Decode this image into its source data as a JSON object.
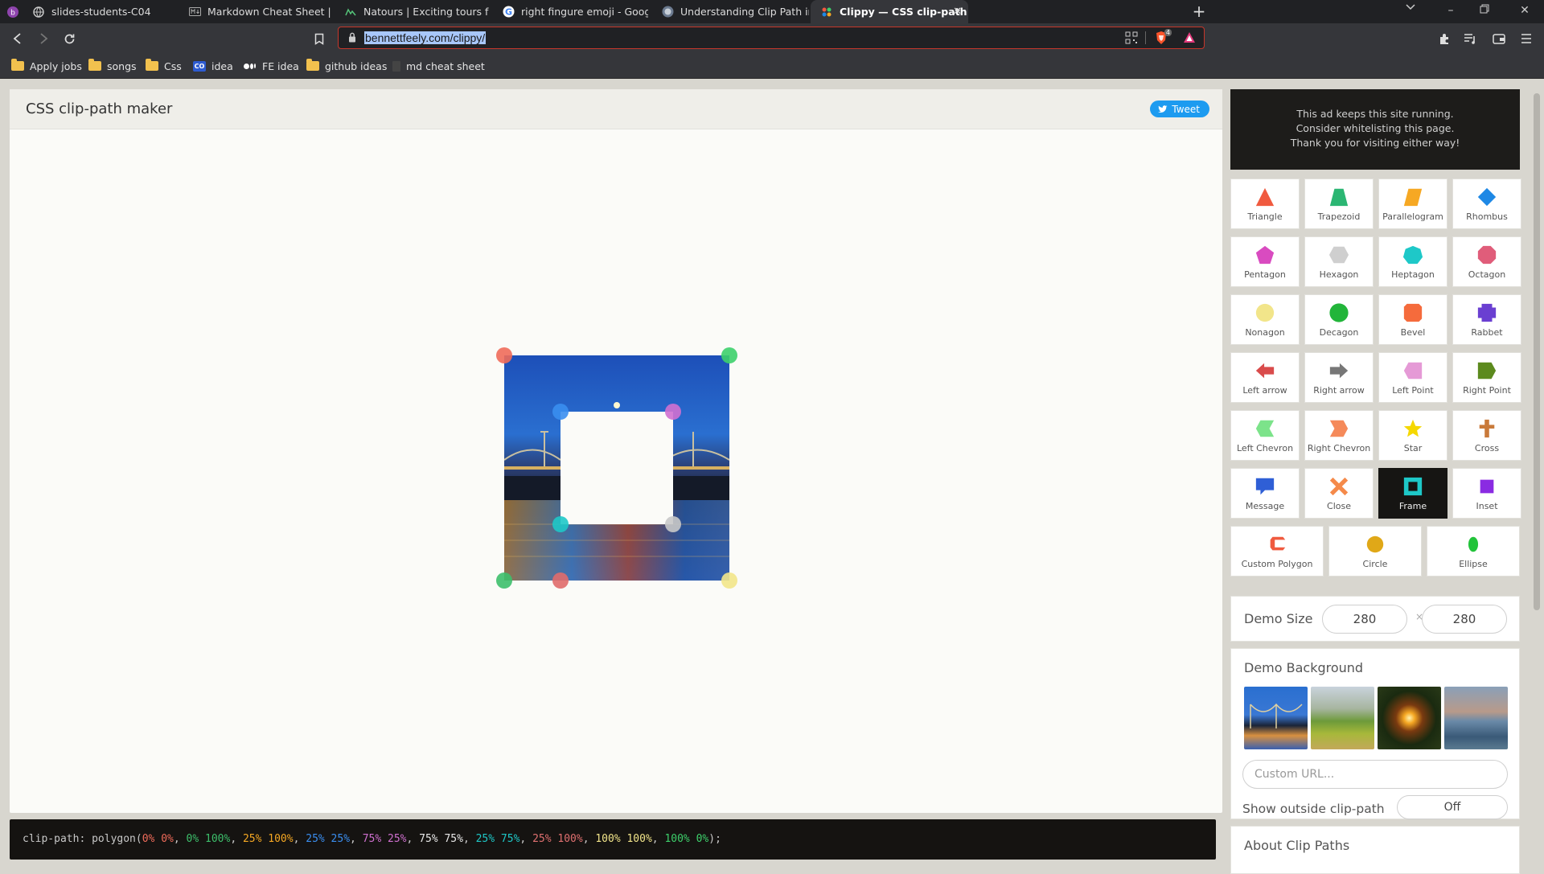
{
  "browser": {
    "tabs": [
      {
        "title": "slides-students-C04",
        "icon": "globe-icon"
      },
      {
        "title": "Markdown Cheat Sheet | Markdown G",
        "icon": "markdown-icon"
      },
      {
        "title": "Natours | Exciting tours for adventuro",
        "icon": "natours-icon"
      },
      {
        "title": "right fingure emoji - Google Search",
        "icon": "google-icon"
      },
      {
        "title": "Understanding Clip Path in CSS - Ahm",
        "icon": "globe-icon"
      },
      {
        "title": "Clippy — CSS clip-path maker",
        "icon": "clippy-icon",
        "active": true
      }
    ],
    "url": "bennettfeely.com/clippy/",
    "brave_badge": "4",
    "bookmarks": [
      {
        "label": "Apply jobs",
        "icon": "folder-icon"
      },
      {
        "label": "songs",
        "icon": "folder-icon"
      },
      {
        "label": "Css",
        "icon": "folder-icon"
      },
      {
        "label": "idea",
        "icon": "codepen-icon"
      },
      {
        "label": "FE idea",
        "icon": "medium-icon"
      },
      {
        "label": "github ideas",
        "icon": "folder-icon"
      },
      {
        "label": "md cheat sheet",
        "icon": "page-icon"
      }
    ]
  },
  "app": {
    "title": "CSS clip-path maker",
    "tweet_label": "Tweet",
    "ad_lines": [
      "This ad keeps this site running.",
      "Consider whitelisting this page.",
      "Thank you for visiting either way!"
    ],
    "shapes": [
      {
        "name": "Triangle",
        "color": "#f05a3f"
      },
      {
        "name": "Trapezoid",
        "color": "#2bb673"
      },
      {
        "name": "Parallelogram",
        "color": "#f6a823"
      },
      {
        "name": "Rhombus",
        "color": "#1e88e5"
      },
      {
        "name": "Pentagon",
        "color": "#d94bc0"
      },
      {
        "name": "Hexagon",
        "color": "#cfcfcf"
      },
      {
        "name": "Heptagon",
        "color": "#1ec8c8"
      },
      {
        "name": "Octagon",
        "color": "#e05d7a"
      },
      {
        "name": "Nonagon",
        "color": "#f2e58a"
      },
      {
        "name": "Decagon",
        "color": "#22b53a"
      },
      {
        "name": "Bevel",
        "color": "#f56b3c"
      },
      {
        "name": "Rabbet",
        "color": "#6a3fd1"
      },
      {
        "name": "Left arrow",
        "color": "#d94b4b"
      },
      {
        "name": "Right arrow",
        "color": "#777777"
      },
      {
        "name": "Left Point",
        "color": "#e59ad6"
      },
      {
        "name": "Right Point",
        "color": "#5c8a1e"
      },
      {
        "name": "Left Chevron",
        "color": "#7ce38a"
      },
      {
        "name": "Right Chevron",
        "color": "#f58a5a"
      },
      {
        "name": "Star",
        "color": "#f5d800"
      },
      {
        "name": "Cross",
        "color": "#c97a3a"
      },
      {
        "name": "Message",
        "color": "#2f5fd6"
      },
      {
        "name": "Close",
        "color": "#f58a4a"
      },
      {
        "name": "Frame",
        "color": "#1ec8c8",
        "selected": true
      },
      {
        "name": "Inset",
        "color": "#8a2be2"
      }
    ],
    "shapes_row7": [
      {
        "name": "Custom Polygon",
        "color": "#f05a3f"
      },
      {
        "name": "Circle",
        "color": "#e0a818"
      },
      {
        "name": "Ellipse",
        "color": "#22c33a"
      }
    ],
    "demo_size": {
      "label": "Demo Size",
      "width": "280",
      "height": "280",
      "separator": "×"
    },
    "demo_background": {
      "label": "Demo Background",
      "custom_url_placeholder": "Custom URL..."
    },
    "outside_clip": {
      "label": "Show outside clip-path",
      "value": "Off"
    },
    "about_heading": "About Clip Paths",
    "code": {
      "prefix": "clip-path: polygon(",
      "points": [
        {
          "text": "0% 0%",
          "color": "#f06b5a"
        },
        {
          "text": "0% 100%",
          "color": "#3dbf6b"
        },
        {
          "text": "25% 100%",
          "color": "#f6a823"
        },
        {
          "text": "25% 25%",
          "color": "#3a8ef0"
        },
        {
          "text": "75% 25%",
          "color": "#d070d0"
        },
        {
          "text": "75% 75%",
          "color": "#e8e8e8"
        },
        {
          "text": "25% 75%",
          "color": "#1ec8c8"
        },
        {
          "text": "25% 100%",
          "color": "#e07070"
        },
        {
          "text": "100% 100%",
          "color": "#f2e58a"
        },
        {
          "text": "100% 0%",
          "color": "#3dd06b"
        }
      ],
      "suffix": ");"
    }
  }
}
